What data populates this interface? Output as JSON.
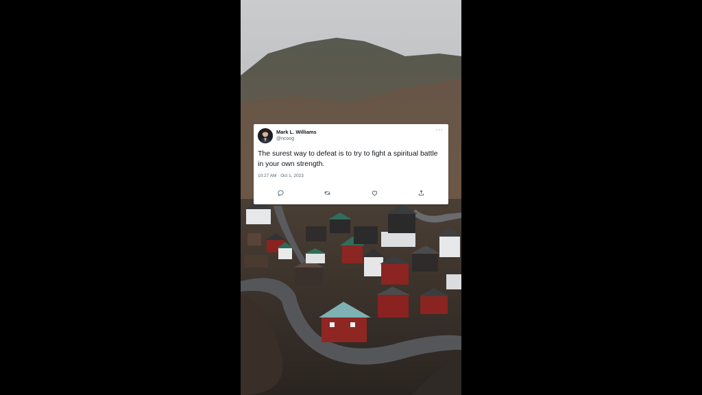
{
  "tweet": {
    "author_name": "Mark L. Williams",
    "author_handle": "@ncoog",
    "more_label": "···",
    "text": "The surest way to defeat is to try to fight a spiritual battle in your own strength.",
    "timestamp": "10:27 AM · Oct 1, 2023",
    "actions": [
      {
        "icon": "reply-icon"
      },
      {
        "icon": "retweet-icon"
      },
      {
        "icon": "like-icon"
      },
      {
        "icon": "share-icon"
      }
    ]
  },
  "colors": {
    "card_bg": "#ffffff",
    "text_primary": "#0f1419",
    "text_secondary": "#536471",
    "letterbox": "#000000"
  }
}
